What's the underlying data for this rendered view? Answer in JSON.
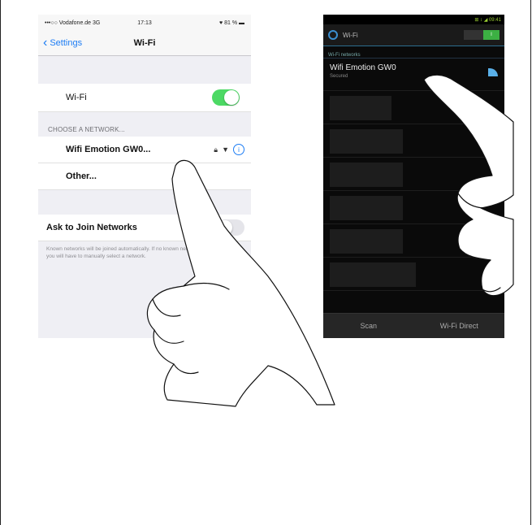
{
  "ios": {
    "status": {
      "carrier": "•••○○ Vodafone.de  3G",
      "time": "17:13",
      "battery": "♥ 81 % ▬"
    },
    "nav": {
      "back_label": "Settings",
      "title": "Wi-Fi"
    },
    "wifi_row": {
      "label": "Wi-Fi",
      "toggle_state": "on"
    },
    "choose_header": "CHOOSE A NETWORK...",
    "networks": [
      {
        "name": "Wifi Emotion GW0..."
      }
    ],
    "other_label": "Other...",
    "ask_row": {
      "label": "Ask to Join Networks"
    },
    "footer_text": "Known networks will be joined automatically. If no known networks are available, you will have to manually select a network."
  },
  "android": {
    "status": {
      "right": "⊞ ↕ ◢ 09:41"
    },
    "title": "Wi-Fi",
    "switch_label": "I",
    "section_label": "Wi-Fi networks",
    "networks": [
      {
        "name": "Wifi Emotion GW0",
        "sub": "Secured"
      }
    ],
    "buttons": {
      "scan": "Scan",
      "direct": "Wi-Fi Direct"
    }
  },
  "colors": {
    "ios_accent": "#1c7cf4",
    "ios_toggle_on": "#4cd964",
    "android_switch_on": "#3cb043",
    "android_accent": "#3b8fd0"
  }
}
